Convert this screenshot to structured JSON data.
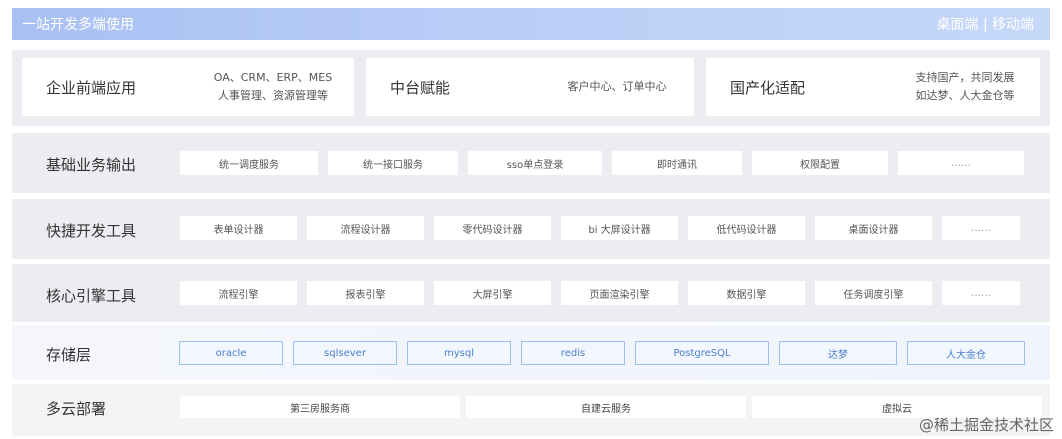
{
  "header": {
    "title": "一站开发多端使用",
    "right": "桌面端 | 移动端"
  },
  "top_cards": [
    {
      "title": "企业前端应用",
      "desc": [
        "OA、CRM、ERP、MES",
        "人事管理、资源管理等"
      ]
    },
    {
      "title": "中台赋能",
      "desc": [
        "客户中心、订单中心"
      ]
    },
    {
      "title": "国产化适配",
      "desc": [
        "支持国产，共同发展",
        "如达梦、人大金仓等"
      ]
    }
  ],
  "rows": [
    {
      "label": "基础业务输出",
      "items": [
        "统一调度服务",
        "统一接口服务",
        "sso单点登录",
        "即时通讯",
        "权限配置",
        "……"
      ]
    },
    {
      "label": "快捷开发工具",
      "items": [
        "表单设计器",
        "流程设计器",
        "零代码设计器",
        "bi 大屏设计器",
        "低代码设计器",
        "桌面设计器",
        "……"
      ]
    },
    {
      "label": "核心引擎工具",
      "items": [
        "流程引擎",
        "报表引擎",
        "大屏引擎",
        "页面渲染引擎",
        "数据引擎",
        "任务调度引擎",
        "……"
      ]
    }
  ],
  "storage": {
    "label": "存储层",
    "items": [
      "oracle",
      "sqlsever",
      "mysql",
      "redis",
      "PostgreSQL",
      "达梦",
      "人大金仓"
    ]
  },
  "deploy": {
    "label": "多云部署",
    "items": [
      "第三房服务商",
      "自建云服务",
      "虚拟云"
    ]
  },
  "watermark": "@稀土掘金技术社区"
}
